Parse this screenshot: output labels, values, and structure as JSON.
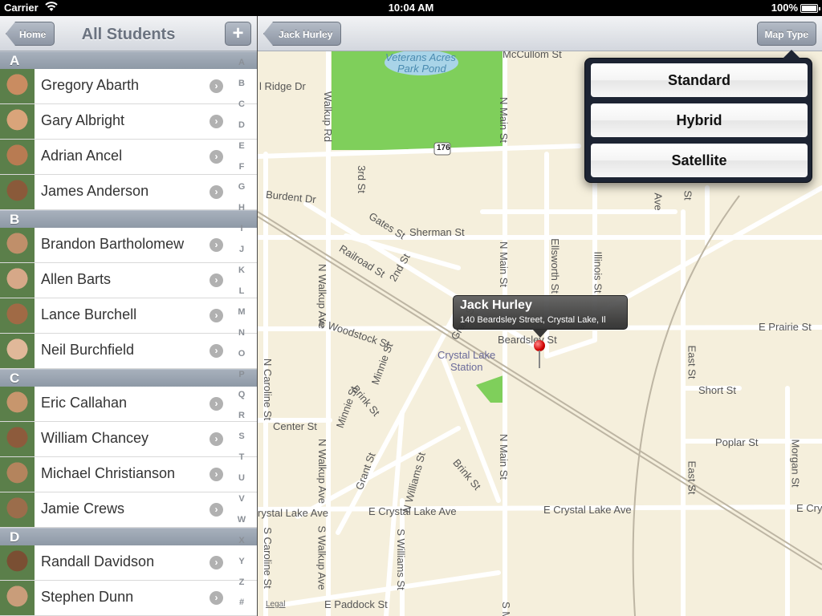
{
  "status": {
    "carrier": "Carrier",
    "time": "10:04 AM",
    "battery": "100%"
  },
  "master": {
    "back_label": "Home",
    "title": "All Students",
    "add_label": "+",
    "sections": [
      {
        "letter": "A",
        "students": [
          "Gregory Abarth",
          "Gary Albright",
          "Adrian Ancel",
          "James Anderson"
        ]
      },
      {
        "letter": "B",
        "students": [
          "Brandon Bartholomew",
          "Allen Barts",
          "Lance Burchell",
          "Neil Burchfield"
        ]
      },
      {
        "letter": "C",
        "students": [
          "Eric Callahan",
          "William Chancey",
          "Michael Christianson",
          "Jamie Crews"
        ]
      },
      {
        "letter": "D",
        "students": [
          "Randall Davidson",
          "Stephen Dunn"
        ]
      }
    ],
    "index": [
      "A",
      "B",
      "C",
      "D",
      "E",
      "F",
      "G",
      "H",
      "I",
      "J",
      "K",
      "L",
      "M",
      "N",
      "O",
      "P",
      "Q",
      "R",
      "S",
      "T",
      "U",
      "V",
      "W",
      "X",
      "Y",
      "Z",
      "#"
    ]
  },
  "detail": {
    "back_label": "Jack Hurley",
    "map_type_label": "Map Type",
    "callout": {
      "title": "Jack Hurley",
      "address": "140 Beardsley Street, Crystal Lake, Il"
    },
    "map_type_options": [
      "Standard",
      "Hybrid",
      "Satellite"
    ],
    "legal": "Legal",
    "map_labels": {
      "veterans_acres": "Veterans Acres",
      "park_pond": "Park Pond",
      "mccullom": "McCullom St",
      "ridge": "l Ridge Dr",
      "burdent": "Burdent Dr",
      "gates": "Gates St",
      "sherman": "Sherman St",
      "railroad": "Railroad St",
      "second": "2nd St",
      "third": "3rd St",
      "grant_n": "Grant St",
      "woodstock": "E Woodstock St",
      "minnie": "Minnie St",
      "minnie2": "Minnie St",
      "crystal_station_1": "Crystal Lake",
      "crystal_station_2": "Station",
      "beardsley": "Beardsley St",
      "prairie": "E Prairie St",
      "short": "Short St",
      "center": "Center St",
      "brink_n": "Brink St",
      "brink_s": "Brink St",
      "poplar": "Poplar St",
      "crystal_ave_w": "rystal Lake Ave",
      "crystal_ave_1": "E Crystal Lake Ave",
      "crystal_ave_2": "E Crystal Lake Ave",
      "crystal_ave_e": "E Cry",
      "paddock": "E Paddock St",
      "walkup_rd": "Walkup Rd",
      "n_walkup": "N Walkup Ave",
      "n_walkup2": "N Walkup Ave",
      "s_walkup": "S Walkup Ave",
      "n_main_top": "N Main St",
      "n_main": "N Main St",
      "n_main_s": "N Main St",
      "s_main": "S M",
      "ellsworth": "Ellsworth St",
      "illinois": "Illinois St",
      "n_caroline": "N Caroline St",
      "s_caroline": "S Caroline St",
      "east_st": "East St",
      "east_st2": "East St",
      "morgan": "Morgan St",
      "n_williams": "N Williams St",
      "s_williams": "S Williams St",
      "grant_s": "Grant St",
      "highway": "176",
      "ave_top": "Ave",
      "st_top": "St"
    }
  }
}
